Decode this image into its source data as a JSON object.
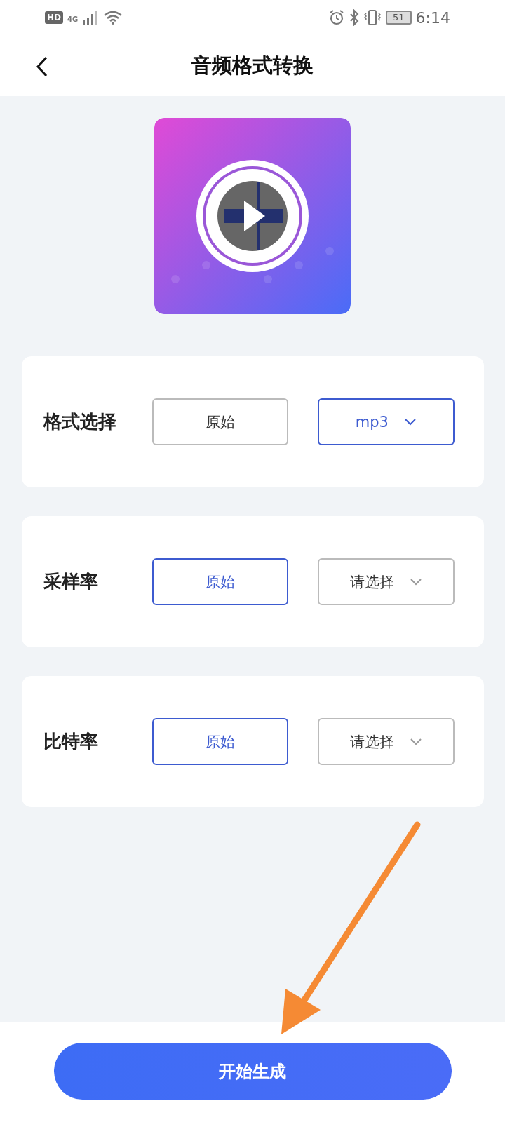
{
  "status_bar": {
    "hd": "HD",
    "network": "4G",
    "battery": "51",
    "time": "6:14"
  },
  "header": {
    "title": "音频格式转换"
  },
  "settings": [
    {
      "label": "格式选择",
      "original": {
        "label": "原始",
        "selected": false
      },
      "dropdown": {
        "value": "mp3",
        "selected": true
      }
    },
    {
      "label": "采样率",
      "original": {
        "label": "原始",
        "selected": true
      },
      "dropdown": {
        "value": "请选择",
        "selected": false
      }
    },
    {
      "label": "比特率",
      "original": {
        "label": "原始",
        "selected": true
      },
      "dropdown": {
        "value": "请选择",
        "selected": false
      }
    }
  ],
  "start_button": {
    "label": "开始生成"
  },
  "annotation": {
    "kind": "arrow"
  }
}
